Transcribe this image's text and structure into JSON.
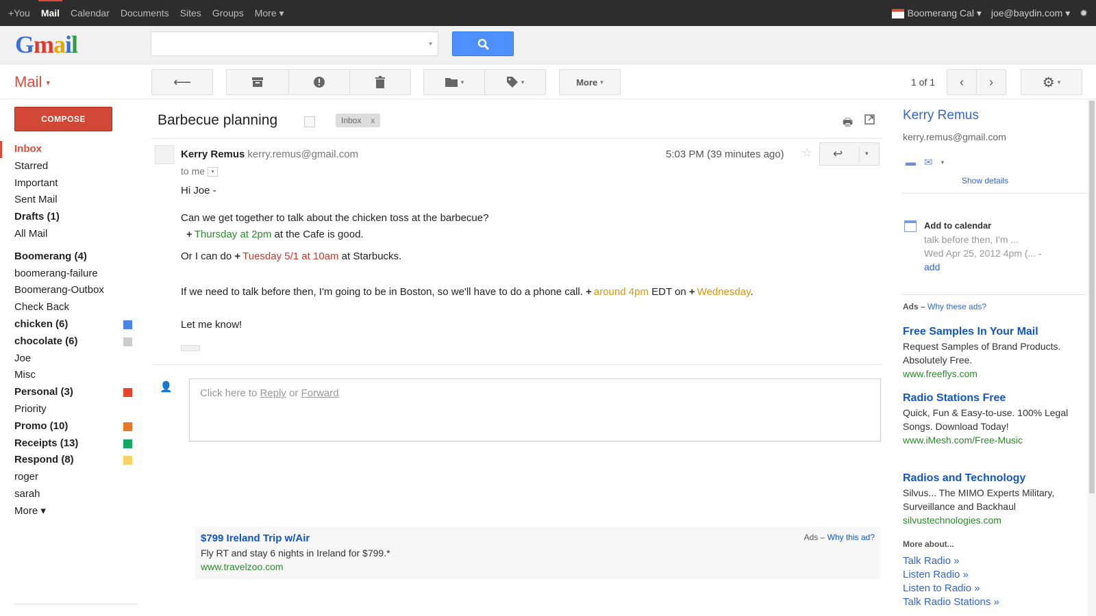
{
  "topbar": {
    "nav": [
      "+You",
      "Mail",
      "Calendar",
      "Documents",
      "Sites",
      "Groups",
      "More ▾"
    ],
    "active": "Mail",
    "boomerang_cal": "Boomerang Cal ▾",
    "account": "joe@baydin.com ▾"
  },
  "logo": {
    "text": "Gmail"
  },
  "search": {
    "value": "",
    "placeholder": ""
  },
  "toolbar": {
    "mail_label": "Mail",
    "more_label": "More",
    "pager": "1 of 1"
  },
  "compose_label": "COMPOSE",
  "sidebar": {
    "items": [
      {
        "label": "Inbox",
        "style": "inbox"
      },
      {
        "label": "Starred",
        "style": ""
      },
      {
        "label": "Important",
        "style": ""
      },
      {
        "label": "Sent Mail",
        "style": ""
      },
      {
        "label": "Drafts (1)",
        "style": "bold"
      },
      {
        "label": "All Mail",
        "style": ""
      },
      {
        "label": "Boomerang (4)",
        "style": "bold gap"
      },
      {
        "label": "boomerang-failure",
        "style": ""
      },
      {
        "label": "Boomerang-Outbox",
        "style": ""
      },
      {
        "label": "Check Back",
        "style": ""
      },
      {
        "label": "chicken (6)",
        "style": "bold",
        "color": "#4a86e8"
      },
      {
        "label": "chocolate (6)",
        "style": "bold",
        "color": "#cccccc"
      },
      {
        "label": "Joe",
        "style": ""
      },
      {
        "label": "Misc",
        "style": ""
      },
      {
        "label": "Personal (3)",
        "style": "bold",
        "color": "#e6452c"
      },
      {
        "label": "Priority",
        "style": ""
      },
      {
        "label": "Promo (10)",
        "style": "bold",
        "color": "#e8772e"
      },
      {
        "label": "Receipts (13)",
        "style": "bold",
        "color": "#16a765"
      },
      {
        "label": "Respond (8)",
        "style": "bold",
        "color": "#fad165"
      },
      {
        "label": "roger",
        "style": ""
      },
      {
        "label": "sarah",
        "style": ""
      },
      {
        "label": "More ▾",
        "style": ""
      }
    ]
  },
  "thread": {
    "subject": "Barbecue planning",
    "tag": "Inbox",
    "sender_name": "Kerry Remus",
    "sender_email": "kerry.remus@gmail.com",
    "to": "to me",
    "time": "5:03 PM (39 minutes ago)",
    "greeting": "Hi Joe -",
    "line1": "Can we get together to talk about the chicken toss at the barbecue?",
    "l2_date": "Thursday at 2pm",
    "l2_rest": " at the Cafe is good.",
    "l3_pre": "Or I can do ",
    "l3_date": "Tuesday 5/1 at 10am",
    "l3_rest": " at Starbucks.",
    "l4_pre": "If we need to talk before then, I'm going to be in Boston, so we'll have to do a phone call. ",
    "l4_date1": "around 4pm",
    "l4_mid": " EDT on ",
    "l4_date2": "Wednesday",
    "l4_end": ".",
    "closing": "Let me know!",
    "reply_hint_pre": "Click here to ",
    "reply_link": "Reply",
    "reply_or": " or ",
    "forward_link": "Forward"
  },
  "bottom_ad": {
    "title": "$799 Ireland Trip w/Air",
    "desc": "Fly RT and stay 6 nights in Ireland for $799.*",
    "url": "www.travelzoo.com",
    "ads_label": "Ads – ",
    "why": "Why this ad?"
  },
  "right_panel": {
    "name": "Kerry Remus",
    "email": "kerry.remus@gmail.com",
    "show_details": "Show details",
    "cal_title": "Add to calendar",
    "cal_snippet": "talk before then, I'm ...",
    "cal_date": "Wed Apr 25, 2012 4pm (... -",
    "cal_add": "add",
    "ads_label": "Ads – ",
    "ads_why": "Why these ads?",
    "ads": [
      {
        "title": "Free Samples In Your Mail",
        "desc": "Request Samples of Brand Products. Absolutely Free.",
        "url": "www.freeflys.com"
      },
      {
        "title": "Radio Stations Free",
        "desc": "Quick, Fun & Easy-to-use. 100% Legal Songs. Download Today!",
        "url": "www.iMesh.com/Free-Music"
      },
      {
        "title": "Radios and Technology",
        "desc": "Silvus... The MIMO Experts Military, Surveillance and Backhaul",
        "url": "silvustechnologies.com"
      }
    ],
    "more_about": "More about...",
    "links": [
      "Talk Radio »",
      "Listen Radio »",
      "Listen to Radio »",
      "Talk Radio Stations »"
    ]
  }
}
